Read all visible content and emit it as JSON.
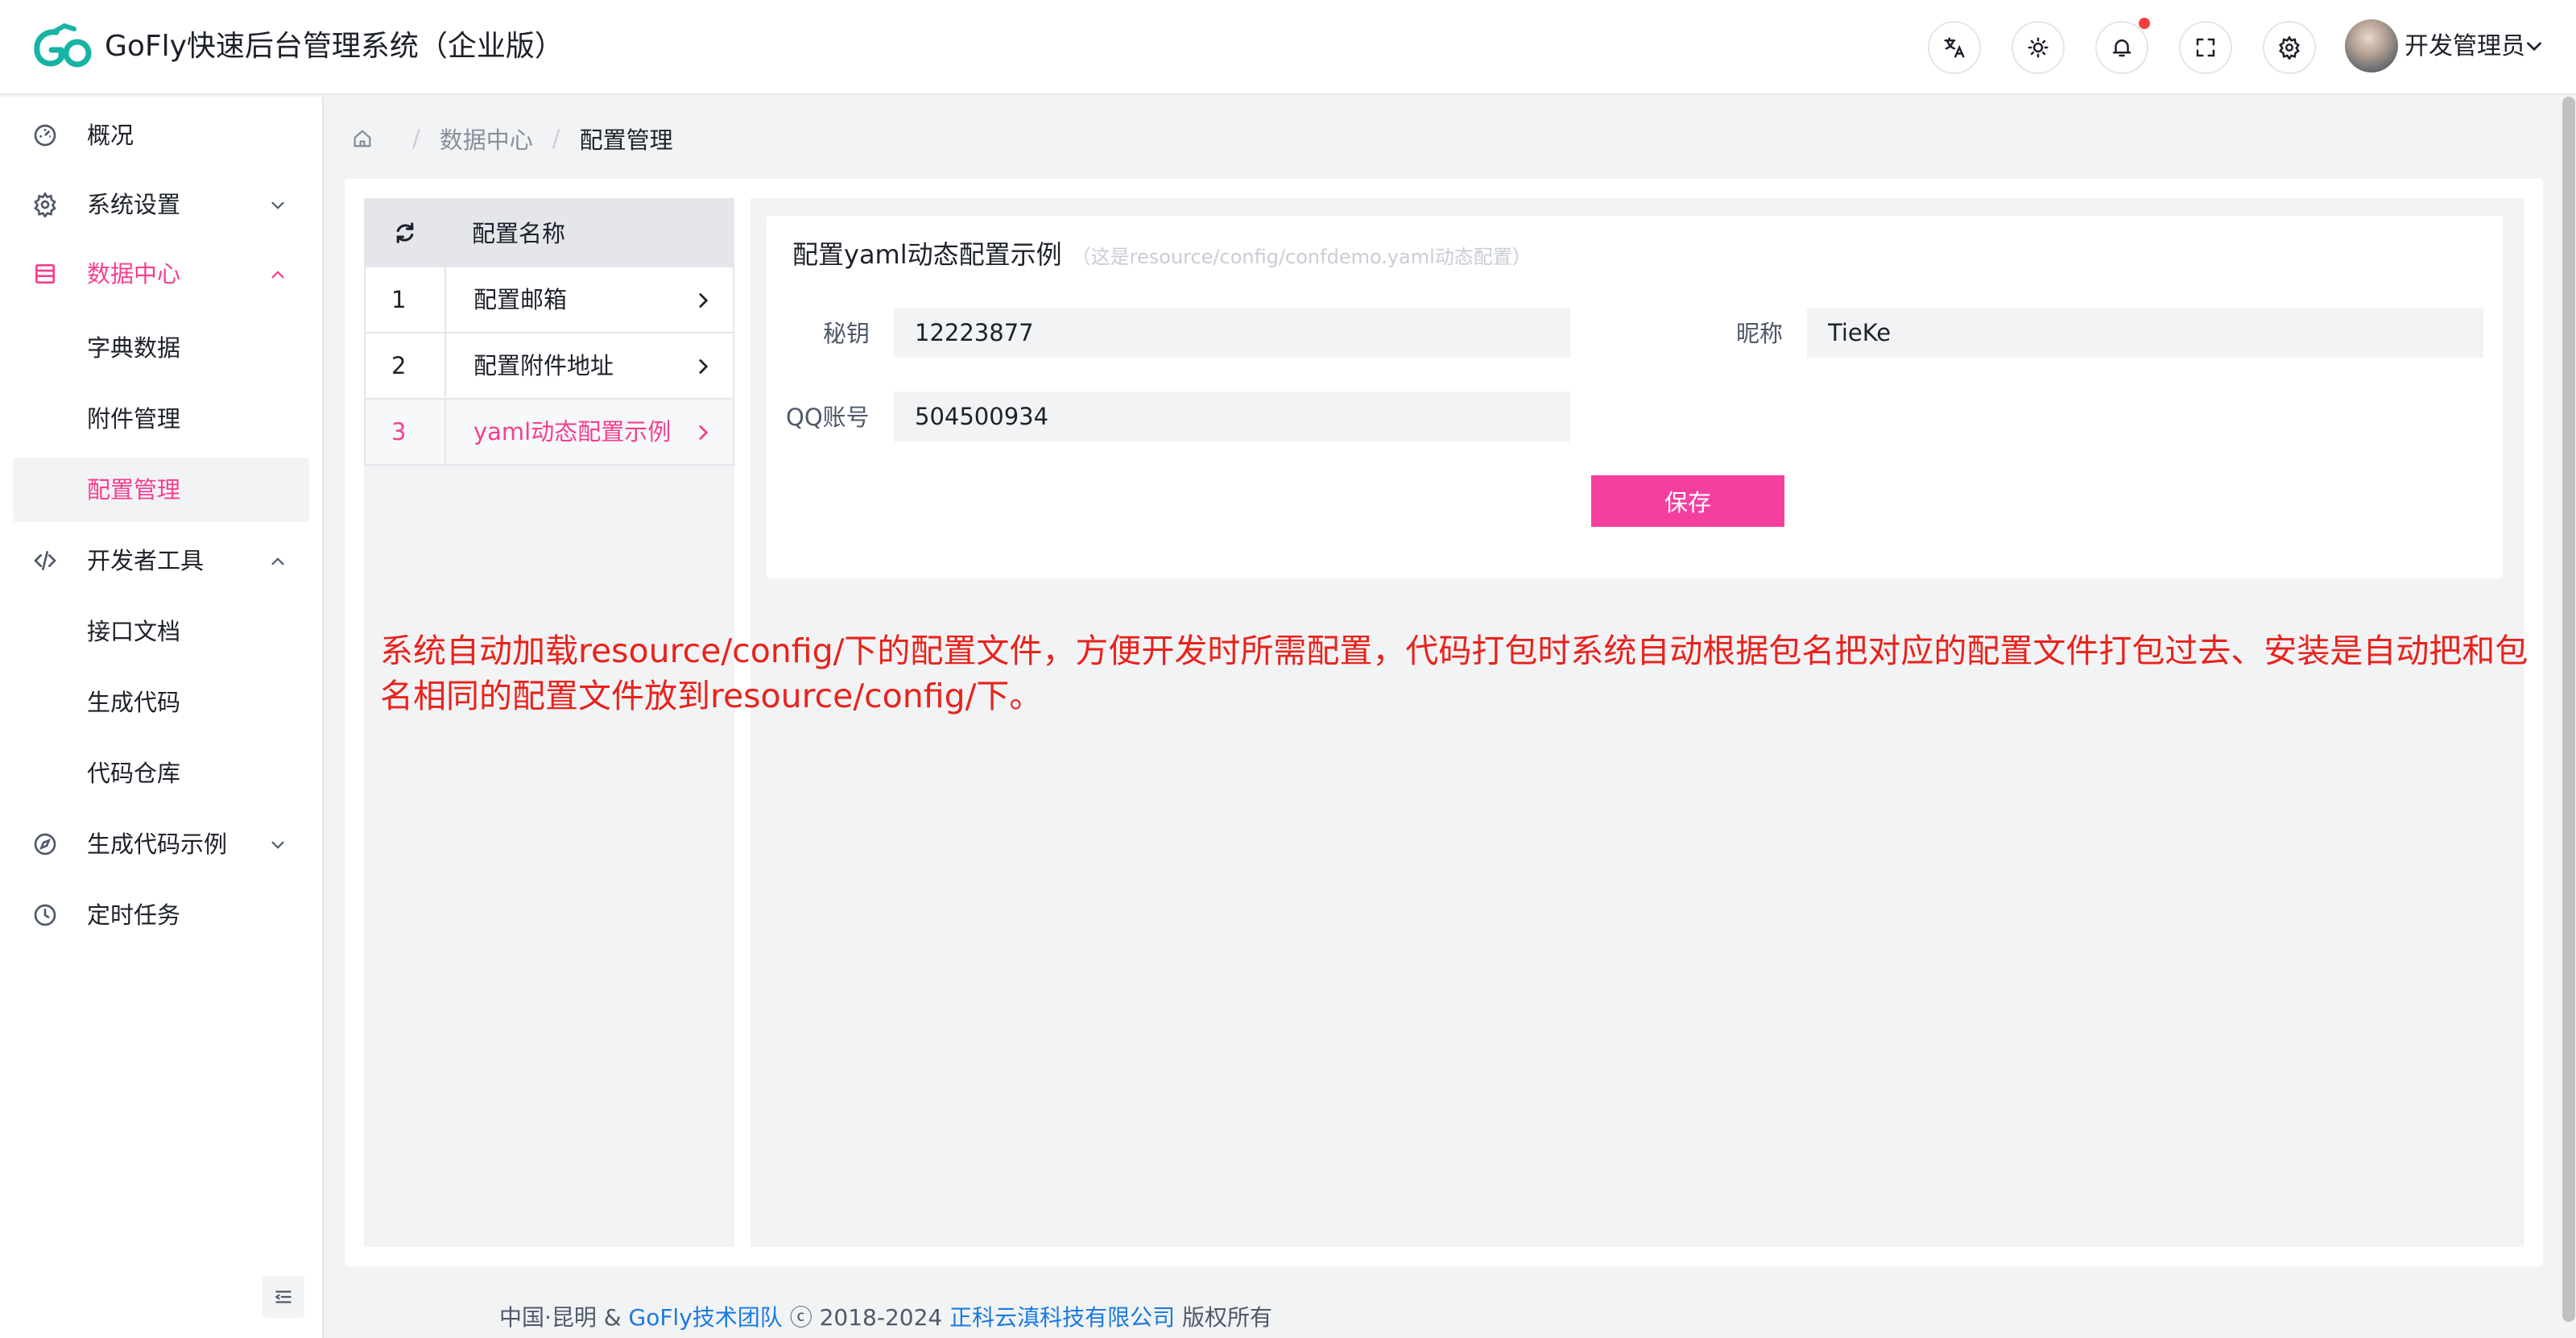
{
  "app": {
    "title": "GoFly快速后台管理系统（企业版）",
    "user_name": "开发管理员",
    "brand_color": "#f53f8f",
    "logo_color": "#17b3a3"
  },
  "header": {
    "icons": [
      "translate-icon",
      "theme-icon",
      "bell-icon",
      "fullscreen-icon",
      "gear-icon"
    ],
    "has_notification_dot": true
  },
  "sidebar": {
    "items": [
      {
        "label": "概况",
        "icon": "dashboard-icon"
      },
      {
        "label": "系统设置",
        "icon": "gear-icon",
        "expanded": false
      },
      {
        "label": "数据中心",
        "icon": "database-icon",
        "expanded": true
      },
      {
        "label": "字典数据"
      },
      {
        "label": "附件管理"
      },
      {
        "label": "配置管理",
        "selected": true
      },
      {
        "label": "开发者工具",
        "icon": "code-icon",
        "expanded": true
      },
      {
        "label": "接口文档"
      },
      {
        "label": "生成代码"
      },
      {
        "label": "代码仓库"
      },
      {
        "label": "生成代码示例",
        "icon": "compass-icon",
        "expanded": false
      },
      {
        "label": "定时任务",
        "icon": "clock-icon"
      }
    ]
  },
  "breadcrumb": {
    "items": [
      "数据中心",
      "配置管理"
    ]
  },
  "config_list": {
    "header": "配置名称",
    "rows": [
      {
        "index": "1",
        "name": "配置邮箱"
      },
      {
        "index": "2",
        "name": "配置附件地址"
      },
      {
        "index": "3",
        "name": "yaml动态配置示例",
        "active": true
      }
    ]
  },
  "form": {
    "title": "配置yaml动态配置示例",
    "hint": "（这是resource/config/confdemo.yaml动态配置）",
    "fields": {
      "secret_label": "秘钥",
      "secret_value": "12223877",
      "nickname_label": "昵称",
      "nickname_value": "TieKe",
      "qq_label": "QQ账号",
      "qq_value": "504500934"
    },
    "save_label": "保存"
  },
  "annotation": "系统自动加载resource/config/下的配置文件，方便开发时所需配置，代码打包时系统自动根据包名把对应的配置文件打包过去、安装是自动把和包名相同的配置文件放到resource/config/下。",
  "footer": {
    "prefix": "中国·昆明 & ",
    "team": "GoFly技术团队",
    "copyright": " ⓒ 2018-2024 ",
    "company": "正科云滇科技有限公司",
    "suffix": " 版权所有"
  }
}
